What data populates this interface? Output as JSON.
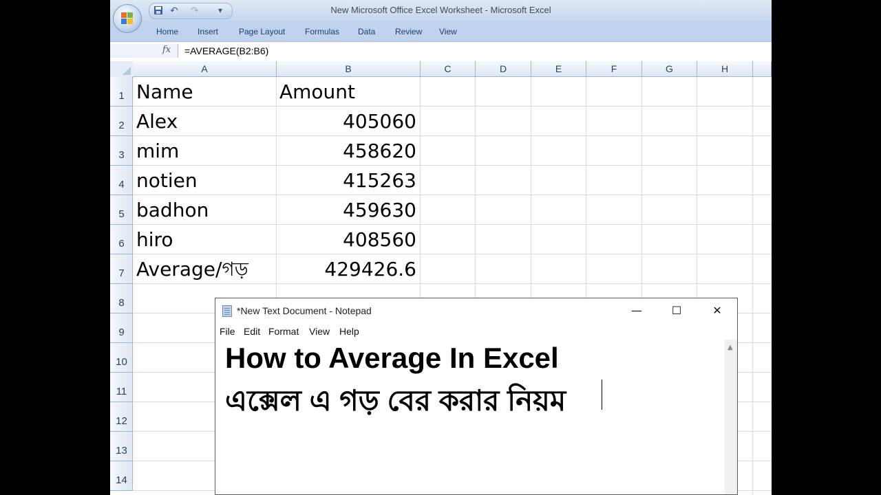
{
  "excel": {
    "window_title": "New Microsoft Office Excel Worksheet - Microsoft Excel",
    "qat": {
      "undo": "↶",
      "redo": "↷",
      "more": "▾"
    },
    "ribbon_tabs": [
      "Home",
      "Insert",
      "Page Layout",
      "Formulas",
      "Data",
      "Review",
      "View"
    ],
    "formula_bar": {
      "fx": "fx",
      "formula": "=AVERAGE(B2:B6)"
    },
    "columns": [
      "A",
      "B",
      "C",
      "D",
      "E",
      "F",
      "G",
      "H"
    ],
    "rows": [
      "1",
      "2",
      "3",
      "4",
      "5",
      "6",
      "7",
      "8",
      "9",
      "10",
      "11",
      "12",
      "13",
      "14"
    ],
    "cells": {
      "A1": "Name",
      "B1": "Amount",
      "A2": "Alex",
      "B2": "405060",
      "A3": "mim",
      "B3": "458620",
      "A4": "notien",
      "B4": "415263",
      "A5": "badhon",
      "B5": "459630",
      "A6": "hiro",
      "B6": "408560",
      "A7": "Average/গড়",
      "B7": "429426.6"
    }
  },
  "notepad": {
    "title": "*New Text Document - Notepad",
    "minimize": "—",
    "maximize": "☐",
    "close": "✕",
    "menu": [
      "File",
      "Edit",
      "Format",
      "View",
      "Help"
    ],
    "lines": [
      "How to Average In Excel",
      "এক্সেল এ গড় বের করার নিয়ম"
    ]
  }
}
